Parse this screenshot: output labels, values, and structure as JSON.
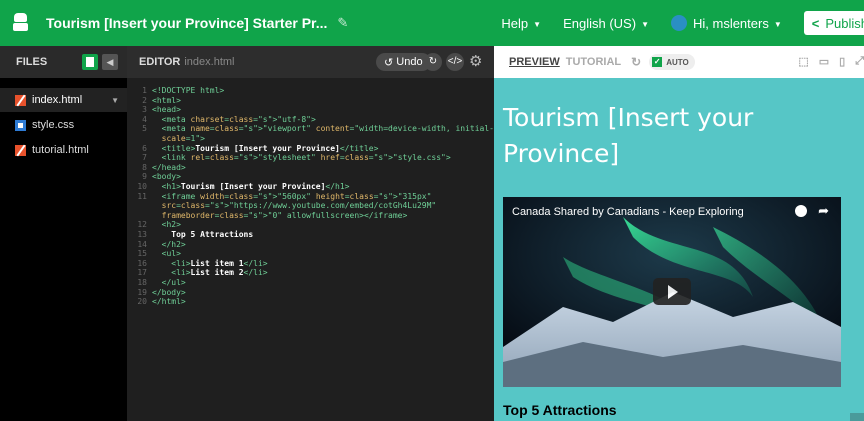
{
  "topbar": {
    "project_title": "Tourism [Insert your Province] Starter Pr...",
    "help": "Help",
    "language": "English (US)",
    "greeting": "Hi, mslenters",
    "publish": "Publish"
  },
  "files": {
    "header": "FILES",
    "items": [
      {
        "name": "index.html",
        "type": "html"
      },
      {
        "name": "style.css",
        "type": "css"
      },
      {
        "name": "tutorial.html",
        "type": "html"
      }
    ]
  },
  "editor": {
    "header": "EDITOR",
    "filename": "index.html",
    "undo": "Undo",
    "lines": [
      {
        "n": "1",
        "text": "<!DOCTYPE html>"
      },
      {
        "n": "2",
        "text": "<html>"
      },
      {
        "n": "3",
        "text": "<head>"
      },
      {
        "n": "4",
        "text": "  <meta charset=\"utf-8\">"
      },
      {
        "n": "5",
        "text": "  <meta name=\"viewport\" content=\"width=device-width, initial-"
      },
      {
        "n": "",
        "text": "  scale=1\">"
      },
      {
        "n": "6",
        "text": "  <title>Tourism [Insert your Province]</title>"
      },
      {
        "n": "7",
        "text": "  <link rel=\"stylesheet\" href=\"style.css\">"
      },
      {
        "n": "8",
        "text": "</head>"
      },
      {
        "n": "9",
        "text": "<body>"
      },
      {
        "n": "10",
        "text": "  <h1>Tourism [Insert your Province]</h1>"
      },
      {
        "n": "11",
        "text": "  <iframe width=\"560px\" height=\"315px\""
      },
      {
        "n": "",
        "text": "  src=\"https://www.youtube.com/embed/cotGh4Lu29M\""
      },
      {
        "n": "",
        "text": "  frameborder=\"0\" allowfullscreen></iframe>"
      },
      {
        "n": "12",
        "text": "  <h2>"
      },
      {
        "n": "13",
        "text": "    Top 5 Attractions"
      },
      {
        "n": "14",
        "text": "  </h2>"
      },
      {
        "n": "15",
        "text": "  <ul>"
      },
      {
        "n": "16",
        "text": "    <li>List item 1</li>"
      },
      {
        "n": "17",
        "text": "    <li>List item 2</li>"
      },
      {
        "n": "18",
        "text": "  </ul>"
      },
      {
        "n": "19",
        "text": "</body>"
      },
      {
        "n": "20",
        "text": "</html>"
      }
    ]
  },
  "preview": {
    "tab_preview": "PREVIEW",
    "tab_tutorial": "TUTORIAL",
    "auto": "AUTO",
    "heading": "Tourism [Insert your Province]",
    "video_title": "Canada Shared by Canadians - Keep Exploring",
    "subheading": "Top 5 Attractions"
  },
  "colors": {
    "brand_green": "#10a44a",
    "preview_bg": "#56c6c6"
  }
}
